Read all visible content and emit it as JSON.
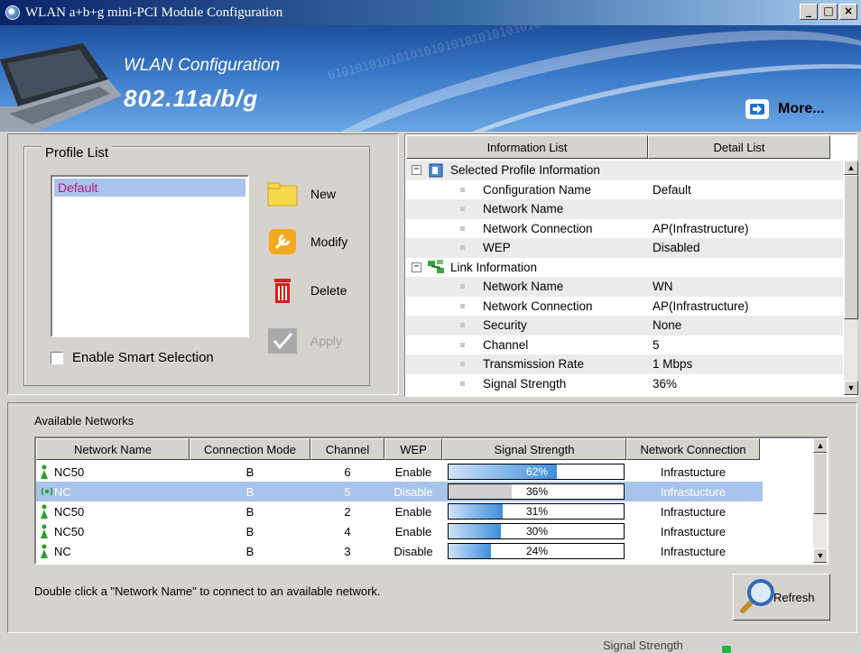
{
  "window": {
    "title": "WLAN a+b+g mini-PCI Module Configuration",
    "buttons": [
      "_",
      "□",
      "×"
    ]
  },
  "banner": {
    "title": "WLAN Configuration",
    "subtitle": "802.11a/b/g",
    "binary_text": "0101010101010101010101010101010",
    "more_label": "More..."
  },
  "profile": {
    "group_label": "Profile List",
    "items": [
      "Default"
    ],
    "enable_smart_selection_label": "Enable Smart Selection",
    "actions": {
      "new": "New",
      "modify": "Modify",
      "delete": "Delete",
      "apply": "Apply"
    }
  },
  "info": {
    "headers": [
      "Information List",
      "Detail List"
    ],
    "selected_profile": {
      "label": "Selected Profile Information",
      "rows": [
        {
          "key": "Configuration Name",
          "value": "Default"
        },
        {
          "key": "Network Name",
          "value": ""
        },
        {
          "key": "Network Connection",
          "value": "AP(Infrastructure)"
        },
        {
          "key": "WEP",
          "value": "Disabled"
        }
      ]
    },
    "link": {
      "label": "Link Information",
      "rows": [
        {
          "key": "Network Name",
          "value": "WN"
        },
        {
          "key": "Network Connection",
          "value": "AP(Infrastructure)"
        },
        {
          "key": "Security",
          "value": "None"
        },
        {
          "key": "Channel",
          "value": "5"
        },
        {
          "key": "Transmission Rate",
          "value": "1 Mbps"
        },
        {
          "key": "Signal Strength",
          "value": "36%"
        }
      ]
    }
  },
  "networks": {
    "title": "Available Networks",
    "columns": [
      "Network Name",
      "Connection Mode",
      "Channel",
      "WEP",
      "Signal Strength",
      "Network Connection"
    ],
    "rows": [
      {
        "name": "NC50",
        "mode": "B",
        "channel": "6",
        "wep": "Enable",
        "signal": "62%",
        "signal_value": 62,
        "connection": "Infrastucture",
        "selected": false
      },
      {
        "name": "NC",
        "mode": "B",
        "channel": "5",
        "wep": "Disable",
        "signal": "36%",
        "signal_value": 36,
        "connection": "Infrastucture",
        "selected": true
      },
      {
        "name": "NC50",
        "mode": "B",
        "channel": "2",
        "wep": "Enable",
        "signal": "31%",
        "signal_value": 31,
        "connection": "Infrastucture",
        "selected": false
      },
      {
        "name": "NC50",
        "mode": "B",
        "channel": "4",
        "wep": "Enable",
        "signal": "30%",
        "signal_value": 30,
        "connection": "Infrastucture",
        "selected": false
      },
      {
        "name": "NC",
        "mode": "B",
        "channel": "3",
        "wep": "Disable",
        "signal": "24%",
        "signal_value": 24,
        "connection": "Infrastucture",
        "selected": false
      }
    ],
    "hint": "Double click a \"Network Name\" to connect to an available network.",
    "refresh_label": "Refresh"
  },
  "status": {
    "label": "Signal Strength"
  },
  "colors": {
    "selection": "#a8c3ec",
    "profile_text": "#c0177a",
    "signal_bar": "#3f8fdc",
    "status_indicator": "#22b14c"
  }
}
